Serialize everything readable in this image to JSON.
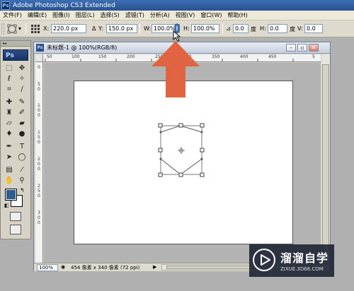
{
  "app": {
    "title": "Adobe Photoshop CS3 Extended",
    "ps_badge": "Ps"
  },
  "menubar": {
    "items": [
      "文件(F)",
      "编辑(E)",
      "图像(I)",
      "图层(L)",
      "选择(S)",
      "滤镜(T)",
      "分析(A)",
      "视图(V)",
      "窗口(W)",
      "帮助(H)"
    ]
  },
  "options": {
    "x_label": "X:",
    "x_value": "220.0 px",
    "y_label": "Y:",
    "y_value": "150.0 px",
    "w_label": "W:",
    "w_value": "100.0%",
    "h_label": "H:",
    "h_value": "100.0%",
    "angle_value": "0.0",
    "angle_unit": "度",
    "skew_h_label": "H:",
    "skew_h_value": "0.0",
    "skew_h_unit": "度",
    "skew_v_label": "V:",
    "skew_v_value": "0.0"
  },
  "tools": {
    "header": "◂◂",
    "logo": "Ps"
  },
  "document": {
    "title": "未标题-1 @ 100%(RGB/8)",
    "zoom": "100%",
    "info": "454 像素 x 340 像素 (72 ppi)",
    "ruler_h": [
      "50",
      "100",
      "150",
      "200",
      "250",
      "300",
      "350",
      "400",
      "450",
      "5"
    ],
    "ruler_v": [
      "0",
      "5",
      "0",
      "1",
      "0",
      "0",
      "1",
      "5",
      "0",
      "2",
      "0",
      "0",
      "2",
      "5",
      "0",
      "3",
      "0",
      "0"
    ],
    "colors": {
      "foreground": "#2f5d8f",
      "background": "#ffffff"
    }
  },
  "annotation": {
    "arrow_color": "#e06442",
    "arrow_icon": "up-arrow-icon"
  },
  "watermark": {
    "name": "溜溜自学",
    "url": "ZIXUE.3D66.COM"
  }
}
